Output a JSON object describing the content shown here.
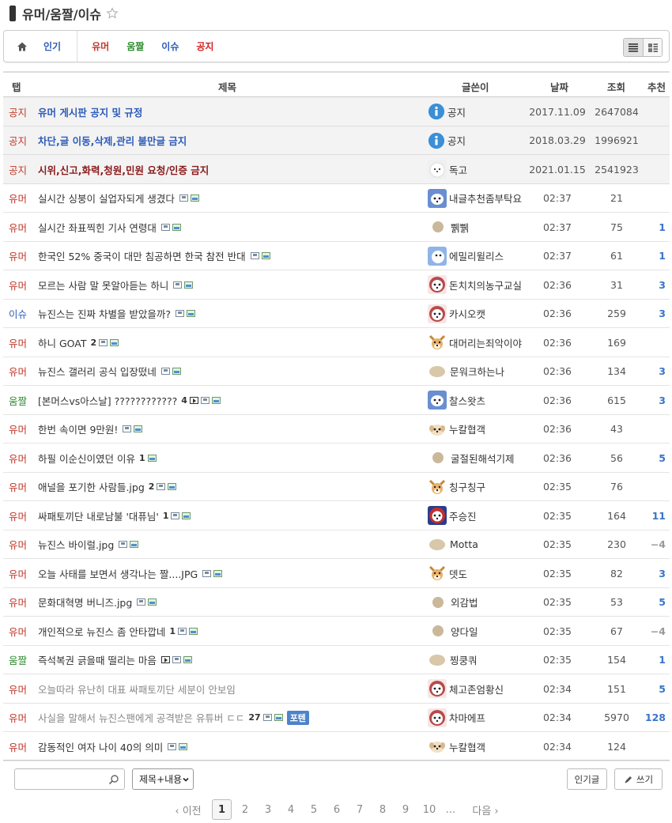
{
  "header": {
    "title": "유머/움짤/이슈"
  },
  "nav": {
    "items": [
      {
        "label": "인기",
        "color": "#2e5bb8"
      },
      {
        "label": "유머",
        "color": "#c0392b"
      },
      {
        "label": "움짤",
        "color": "#2e8b2e"
      },
      {
        "label": "이슈",
        "color": "#2e5bb8"
      },
      {
        "label": "공지",
        "color": "#d42020"
      }
    ]
  },
  "table": {
    "headers": {
      "tab": "탭",
      "title": "제목",
      "author": "글쓴이",
      "date": "날짜",
      "views": "조회",
      "rec": "추천"
    },
    "rows": [
      {
        "tab": "공지",
        "title": "유머 게시판 공지 및 규정",
        "author": "공지",
        "date": "2017.11.09",
        "views": "2647084",
        "rec": "",
        "comments": "",
        "kind": "notice",
        "tc": "title-notice-blue",
        "avatar": "info"
      },
      {
        "tab": "공지",
        "title": "차단,글 이동,삭제,관리 불만글 금지",
        "author": "공지",
        "date": "2018.03.29",
        "views": "1996921",
        "rec": "",
        "comments": "",
        "kind": "notice",
        "tc": "title-notice-blue",
        "avatar": "info"
      },
      {
        "tab": "공지",
        "title": "시위,신고,화력,청원,민원 요청/인증 금지",
        "author": "독고",
        "date": "2021.01.15",
        "views": "2541923",
        "rec": "",
        "comments": "",
        "kind": "notice",
        "tc": "title-notice-red",
        "avatar": "dogw"
      },
      {
        "tab": "유머",
        "title": "실시간 싱붕이 실업자되게 생겼다",
        "author": "내글추천좀부탁요",
        "date": "02:37",
        "views": "21",
        "rec": "",
        "comments": "",
        "kind": "humor",
        "icons": [
          "doc",
          "img"
        ],
        "avatar": "blue"
      },
      {
        "tab": "유머",
        "title": "실시간 좌표찍힌 기사 연령대",
        "author": "쀍쀍",
        "date": "02:37",
        "views": "75",
        "rec": "1",
        "comments": "",
        "kind": "humor",
        "icons": [
          "doc",
          "img"
        ],
        "avatar": "dot"
      },
      {
        "tab": "유머",
        "title": "한국인 52% 중국이 대만 침공하면 한국 참전 반대",
        "author": "에밀리윌리스",
        "date": "02:37",
        "views": "61",
        "rec": "1",
        "comments": "",
        "kind": "humor",
        "icons": [
          "doc",
          "img"
        ],
        "avatar": "blue2"
      },
      {
        "tab": "유머",
        "title": "모르는 사람 말 못알아듣는 하니",
        "author": "돈치치의농구교실",
        "date": "02:36",
        "views": "31",
        "rec": "3",
        "comments": "",
        "kind": "humor",
        "icons": [
          "doc",
          "img"
        ],
        "avatar": "redface"
      },
      {
        "tab": "이슈",
        "title": "뉴진스는 진짜 차별을 받았을까?",
        "author": "카시오캣",
        "date": "02:36",
        "views": "259",
        "rec": "3",
        "comments": "",
        "kind": "issue",
        "icons": [
          "doc",
          "img"
        ],
        "avatar": "redface"
      },
      {
        "tab": "유머",
        "title": "하니 GOAT",
        "author": "대머리는죄악이야",
        "date": "02:36",
        "views": "169",
        "rec": "",
        "comments": "2",
        "kind": "humor",
        "icons": [
          "doc",
          "img"
        ],
        "avatar": "dog"
      },
      {
        "tab": "유머",
        "title": "뉴진스 갤러리 공식 입장떴네",
        "author": "문워크하는나",
        "date": "02:36",
        "views": "134",
        "rec": "3",
        "comments": "",
        "kind": "humor",
        "icons": [
          "doc",
          "img"
        ],
        "avatar": "dotw"
      },
      {
        "tab": "움짤",
        "title": "[본머스vs아스날] ????????????",
        "author": "찰스왓츠",
        "date": "02:36",
        "views": "615",
        "rec": "3",
        "comments": "4",
        "kind": "umjjal",
        "icons": [
          "vid",
          "doc",
          "img"
        ],
        "avatar": "blue"
      },
      {
        "tab": "유머",
        "title": "한번 속이면 9만원!",
        "author": "누칼협객",
        "date": "02:36",
        "views": "43",
        "rec": "",
        "comments": "",
        "kind": "humor",
        "icons": [
          "doc",
          "img"
        ],
        "avatar": "puppy"
      },
      {
        "tab": "유머",
        "title": "하필 이순신이였던 이유",
        "author": "굴절된해석기제",
        "date": "02:36",
        "views": "56",
        "rec": "5",
        "comments": "1",
        "kind": "humor",
        "icons": [
          "img"
        ],
        "avatar": "dot"
      },
      {
        "tab": "유머",
        "title": "애널을 포기한 사람들.jpg",
        "author": "칭구칭구",
        "date": "02:35",
        "views": "76",
        "rec": "",
        "comments": "2",
        "kind": "humor",
        "icons": [
          "doc",
          "img"
        ],
        "avatar": "dog"
      },
      {
        "tab": "유머",
        "title": "싸패토끼단 내로남불 '대퓨님'",
        "author": "주승진",
        "date": "02:35",
        "views": "164",
        "rec": "11",
        "comments": "1",
        "kind": "humor",
        "icons": [
          "doc",
          "img"
        ],
        "avatar": "redblue"
      },
      {
        "tab": "유머",
        "title": "뉴진스 바이럴.jpg",
        "author": "Motta",
        "date": "02:35",
        "views": "230",
        "rec": "−4",
        "comments": "",
        "kind": "humor",
        "icons": [
          "doc",
          "img"
        ],
        "avatar": "dotw"
      },
      {
        "tab": "유머",
        "title": "오늘 사태를 보면서 생각나는 짤....JPG",
        "author": "뎃도",
        "date": "02:35",
        "views": "82",
        "rec": "3",
        "comments": "",
        "kind": "humor",
        "icons": [
          "doc",
          "img"
        ],
        "avatar": "dog"
      },
      {
        "tab": "유머",
        "title": "문화대혁명 버니즈.jpg",
        "author": "외감법",
        "date": "02:35",
        "views": "53",
        "rec": "5",
        "comments": "",
        "kind": "humor",
        "icons": [
          "doc",
          "img"
        ],
        "avatar": "dot"
      },
      {
        "tab": "유머",
        "title": "개인적으로 뉴진스 좀 안타깝네",
        "author": "양다일",
        "date": "02:35",
        "views": "67",
        "rec": "−4",
        "comments": "1",
        "kind": "humor",
        "icons": [
          "doc",
          "img"
        ],
        "avatar": "dot"
      },
      {
        "tab": "움짤",
        "title": "즉석복권 긁을때 떨리는 마음",
        "author": "찡쿵쿼",
        "date": "02:35",
        "views": "154",
        "rec": "1",
        "comments": "",
        "kind": "umjjal",
        "icons": [
          "vid",
          "doc",
          "img"
        ],
        "avatar": "dotw"
      },
      {
        "tab": "유머",
        "title": "오늘따라 유난히 대표 싸패토끼단 세분이 안보임",
        "author": "체고존엄황신",
        "date": "02:34",
        "views": "151",
        "rec": "5",
        "comments": "",
        "kind": "humor",
        "icons": [],
        "dim": true,
        "avatar": "redface"
      },
      {
        "tab": "유머",
        "title": "사실을 말해서 뉴진스팬에게 공격받은 유튜버 ㄷㄷ",
        "author": "차마에프",
        "date": "02:34",
        "views": "5970",
        "rec": "128",
        "comments": "27",
        "kind": "humor",
        "icons": [
          "doc",
          "img"
        ],
        "dim": true,
        "badge": "포텐",
        "avatar": "redface"
      },
      {
        "tab": "유머",
        "title": "감동적인 여자 나이 40의 의미",
        "author": "누칼협객",
        "date": "02:34",
        "views": "124",
        "rec": "",
        "comments": "",
        "kind": "humor",
        "icons": [
          "doc",
          "img"
        ],
        "avatar": "puppy"
      }
    ]
  },
  "footer": {
    "search_placeholder": "",
    "select_value": "제목+내용",
    "popular_button": "인기글",
    "write_button": "쓰기"
  },
  "pager": {
    "prev": "‹ 이전",
    "pages": [
      "1",
      "2",
      "3",
      "4",
      "5",
      "6",
      "7",
      "8",
      "9",
      "10"
    ],
    "current": "1",
    "ellipsis": "...",
    "next": "다음 ›"
  },
  "colors": {
    "accent": "#3a74c9",
    "humor": "#c0392b",
    "issue": "#2e5bb8",
    "umjjal": "#2e8b2e"
  }
}
